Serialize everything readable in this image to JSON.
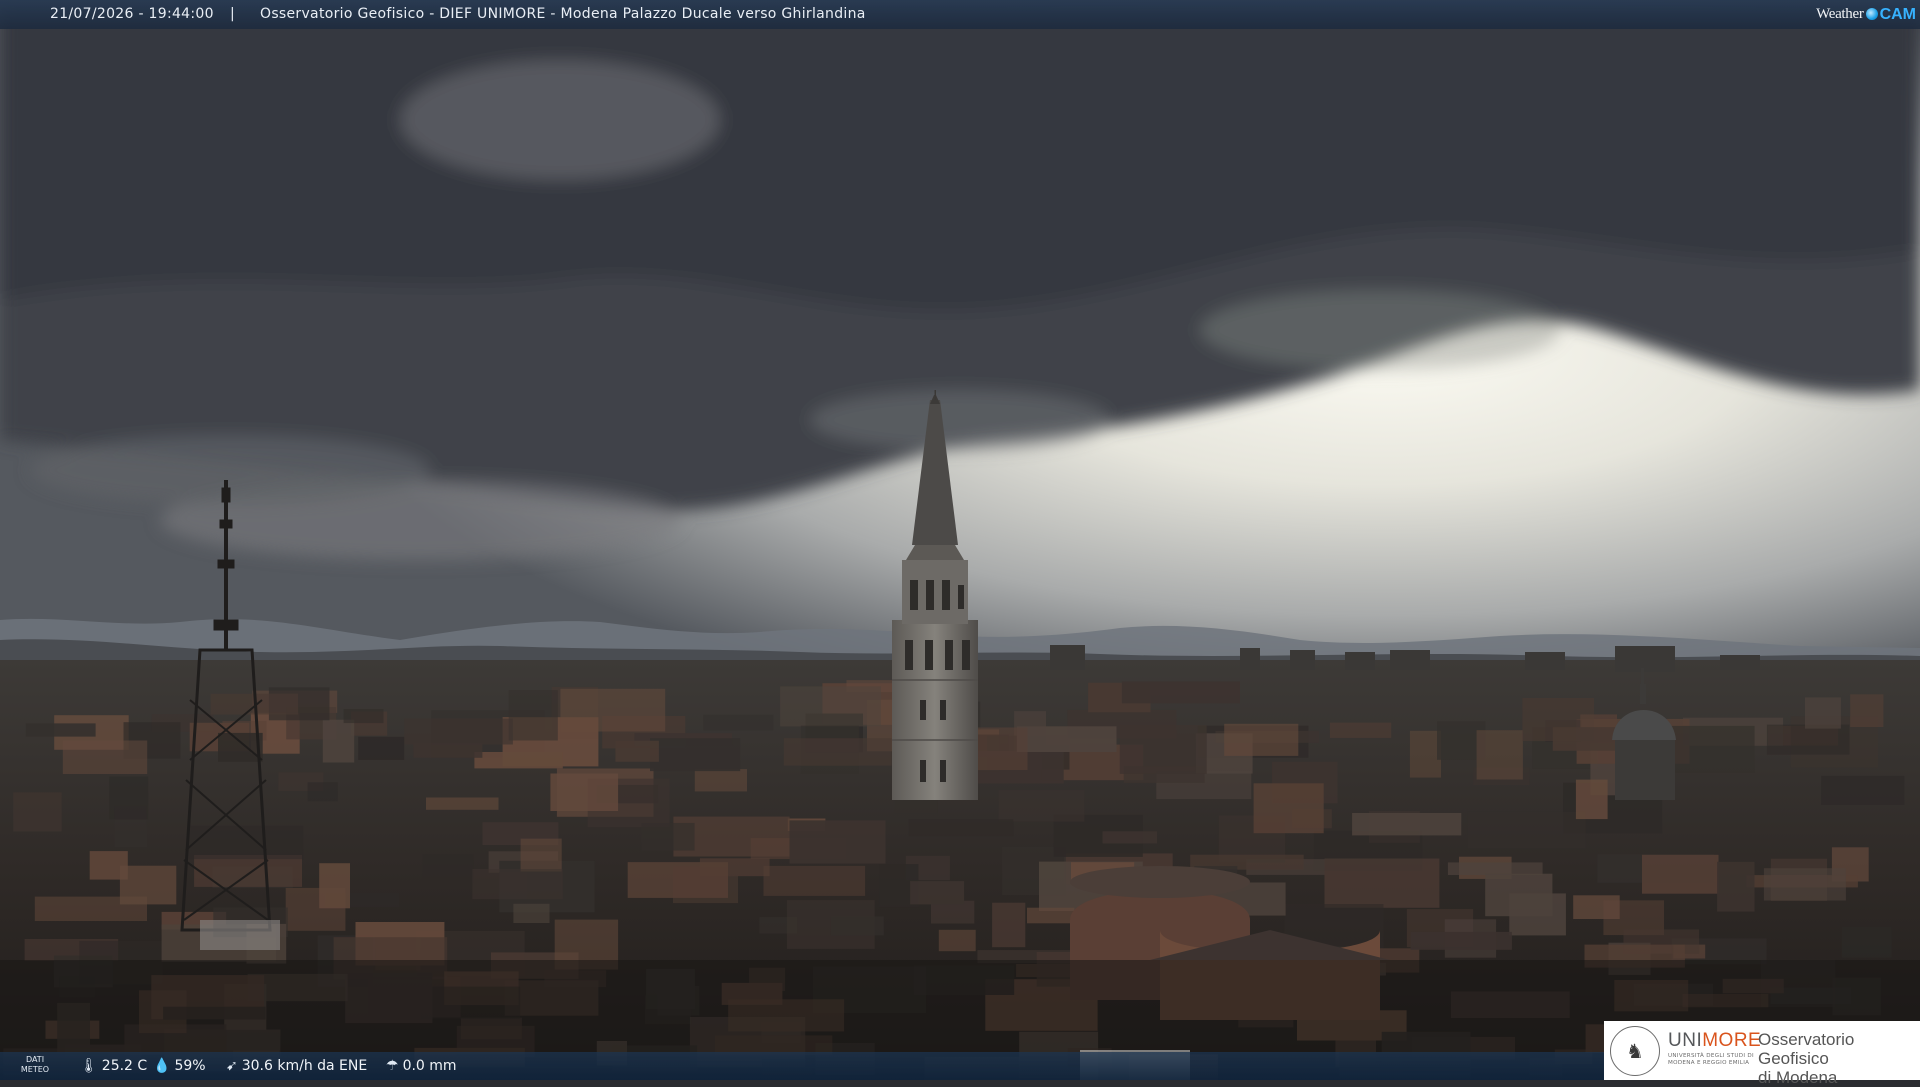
{
  "header": {
    "datetime": "21/07/2026 - 19:44:00",
    "separator": "|",
    "location": "Osservatorio Geofisico - DIEF UNIMORE - Modena Palazzo Ducale verso Ghirlandina"
  },
  "brand": {
    "word": "Weather",
    "suffix": "CAM"
  },
  "footer": {
    "dati_meteo": "DATI METEO",
    "temperature": "25.2 C",
    "humidity": "59%",
    "wind": "30.6 km/h da ENE",
    "rain": "0.0 mm"
  },
  "logo": {
    "uni_part1": "UNI",
    "uni_part2": "MORE",
    "university_sub": "UNIVERSITÀ DEGLI STUDI DI MODENA E REGGIO EMILIA",
    "observatory_line1": "Osservatorio Geofisico",
    "observatory_line2": "di Modena"
  },
  "colors": {
    "sky_dark": "#3b3f46",
    "sky_bright": "#f3f1e6",
    "city": "#2e2a27",
    "accent_orange": "#d9541d",
    "brand_blue": "#37b2ff"
  }
}
